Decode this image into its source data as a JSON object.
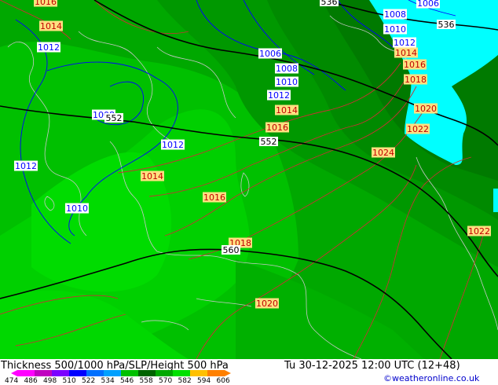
{
  "title": "Thickness 500/1000 hPa/SLP/Height 500 hPa",
  "valid_time": "Tu 30-12-2025 12:00 UTC (12+48)",
  "credit": "©weatheronline.co.uk",
  "colors": {
    "thickness_bands": [
      "#00a800",
      "#00c000",
      "#00d800",
      "#009000",
      "#007800",
      "#006400"
    ],
    "cold_region": "#00ffff",
    "isobar_low": "#0000ff",
    "isobar_high": "#c00000",
    "height_contour": "#000000",
    "coastline": "#c8c8c8"
  },
  "legend": {
    "values": [
      "474",
      "486",
      "498",
      "510",
      "522",
      "534",
      "546",
      "558",
      "570",
      "582",
      "594",
      "606"
    ],
    "colors": [
      "#ff00ff",
      "#c000c0",
      "#7a00ff",
      "#0000ff",
      "#0070ff",
      "#00a0ff",
      "#00c000",
      "#006400",
      "#00a800",
      "#00e000",
      "#ffc000",
      "#ff8000"
    ]
  },
  "isobar_labels": [
    {
      "value": "1016",
      "kind": "high"
    },
    {
      "value": "1014",
      "kind": "high"
    },
    {
      "value": "1012",
      "kind": "low"
    },
    {
      "value": "1006",
      "kind": "low"
    },
    {
      "value": "1008",
      "kind": "low"
    },
    {
      "value": "1010",
      "kind": "low"
    },
    {
      "value": "1012",
      "kind": "low"
    },
    {
      "value": "1014",
      "kind": "high"
    },
    {
      "value": "1016",
      "kind": "high"
    },
    {
      "value": "1008",
      "kind": "low"
    },
    {
      "value": "1012",
      "kind": "low"
    },
    {
      "value": "1012",
      "kind": "low"
    },
    {
      "value": "1014",
      "kind": "high"
    },
    {
      "value": "1016",
      "kind": "high"
    },
    {
      "value": "1010",
      "kind": "low"
    },
    {
      "value": "1018",
      "kind": "high"
    },
    {
      "value": "1020",
      "kind": "high"
    },
    {
      "value": "1008",
      "kind": "low"
    },
    {
      "value": "1010",
      "kind": "low"
    },
    {
      "value": "1012",
      "kind": "low"
    },
    {
      "value": "1014",
      "kind": "high"
    },
    {
      "value": "1016",
      "kind": "high"
    },
    {
      "value": "1018",
      "kind": "high"
    },
    {
      "value": "1020",
      "kind": "high"
    },
    {
      "value": "1022",
      "kind": "high"
    },
    {
      "value": "1024",
      "kind": "high"
    },
    {
      "value": "1022",
      "kind": "high"
    },
    {
      "value": "1006",
      "kind": "low"
    }
  ],
  "height_labels": [
    "536",
    "536",
    "552",
    "552",
    "560"
  ]
}
